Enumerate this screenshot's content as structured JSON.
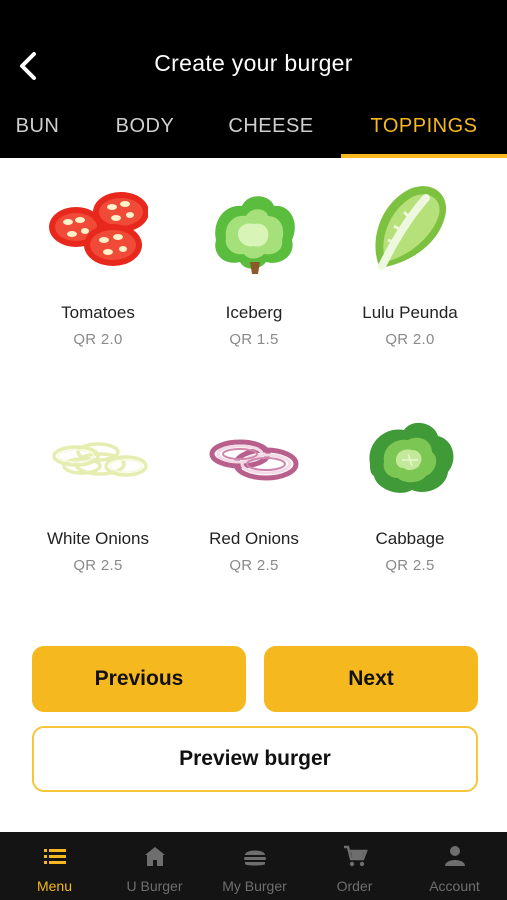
{
  "header": {
    "title": "Create your burger"
  },
  "tabs": [
    {
      "label": "BUN",
      "active": false
    },
    {
      "label": "BODY",
      "active": false
    },
    {
      "label": "CHEESE",
      "active": false
    },
    {
      "label": "TOPPINGS",
      "active": true
    }
  ],
  "items": [
    {
      "name": "Tomatoes",
      "price": "QR 2.0",
      "icon": "tomato-slices-icon"
    },
    {
      "name": "Iceberg",
      "price": "QR 1.5",
      "icon": "iceberg-lettuce-icon"
    },
    {
      "name": "Lulu Peunda",
      "price": "QR 2.0",
      "icon": "napa-cabbage-leaf-icon"
    },
    {
      "name": "White Onions",
      "price": "QR 2.5",
      "icon": "white-onion-rings-icon"
    },
    {
      "name": "Red Onions",
      "price": "QR 2.5",
      "icon": "red-onion-rings-icon"
    },
    {
      "name": "Cabbage",
      "price": "QR 2.5",
      "icon": "cabbage-icon"
    }
  ],
  "buttons": {
    "previous": "Previous",
    "next": "Next",
    "preview": "Preview burger"
  },
  "nav": [
    {
      "label": "Menu",
      "icon": "menu-list-icon",
      "active": true
    },
    {
      "label": "U Burger",
      "icon": "home-icon",
      "active": false
    },
    {
      "label": "My Burger",
      "icon": "burger-icon",
      "active": false
    },
    {
      "label": "Order",
      "icon": "cart-icon",
      "active": false
    },
    {
      "label": "Account",
      "icon": "user-icon",
      "active": false
    }
  ],
  "colors": {
    "accent": "#f5b81e",
    "header_bg": "#000000",
    "nav_bg": "#141414",
    "nav_inactive": "#6e6e6e"
  }
}
